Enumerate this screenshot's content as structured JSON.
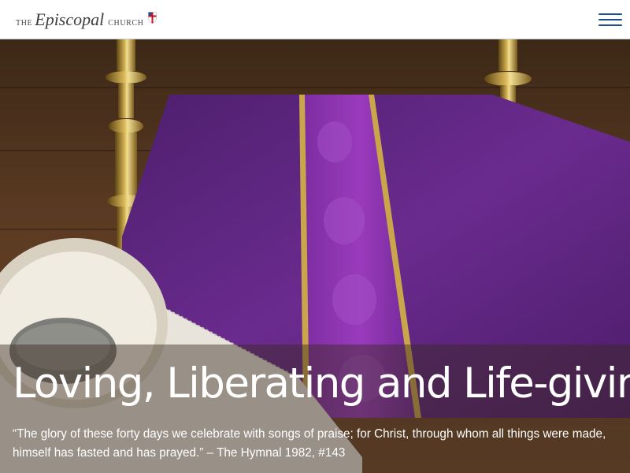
{
  "header": {
    "logo": {
      "prefix": "the",
      "name": "Episcopal",
      "suffix": "church",
      "icon": "episcopal-shield-icon"
    },
    "menu_icon": "hamburger-menu-icon",
    "menu_color": "#1b4f8f"
  },
  "hero": {
    "headline": "Loving, Liberating and Life-giving",
    "quote": "“The glory of these forty days we celebrate with songs of praise; for Christ, through whom all things were made, himself has fasted and has prayed.” – The Hymnal 1982, #143",
    "accent_colors": {
      "cloth": "#6a2b8e",
      "brass": "#c9a64a",
      "wood": "#5a3a22"
    }
  }
}
